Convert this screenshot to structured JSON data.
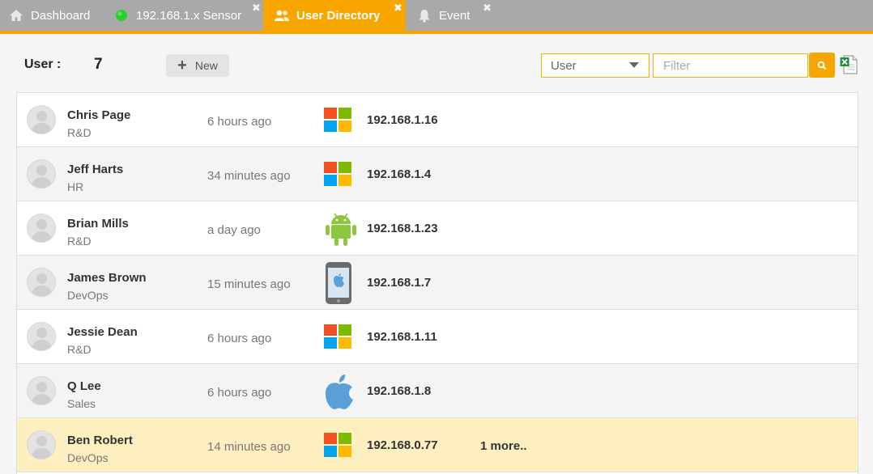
{
  "tabs": [
    {
      "label": "Dashboard",
      "icon": "home-icon"
    },
    {
      "label": "192.168.1.x Sensor",
      "icon": "green-dot-icon",
      "closable": true
    },
    {
      "label": "User Directory",
      "icon": "users-icon",
      "closable": true,
      "active": true
    },
    {
      "label": "Event",
      "icon": "bell-icon",
      "closable": true
    }
  ],
  "header": {
    "user_label": "User :",
    "user_count": "7",
    "new_label": "New",
    "select_value": "User",
    "filter_placeholder": "Filter"
  },
  "colors": {
    "accent": "#f7a600",
    "tabbar": "#a9a9a9",
    "selected_row": "#fdefc0"
  },
  "users": [
    {
      "name": "Chris Page",
      "dept": "R&D",
      "time": "6 hours ago",
      "device": "windows",
      "ip": "192.168.1.16"
    },
    {
      "name": "Jeff Harts",
      "dept": "HR",
      "time": "34 minutes ago",
      "device": "windows",
      "ip": "192.168.1.4"
    },
    {
      "name": "Brian Mills",
      "dept": "R&D",
      "time": "a day ago",
      "device": "android",
      "ip": "192.168.1.23"
    },
    {
      "name": "James Brown",
      "dept": "DevOps",
      "time": "15 minutes ago",
      "device": "iphone",
      "ip": "192.168.1.7"
    },
    {
      "name": "Jessie Dean",
      "dept": "R&D",
      "time": "6 hours ago",
      "device": "windows",
      "ip": "192.168.1.11"
    },
    {
      "name": "Q Lee",
      "dept": "Sales",
      "time": "6 hours ago",
      "device": "apple",
      "ip": "192.168.1.8"
    },
    {
      "name": "Ben Robert",
      "dept": "DevOps",
      "time": "14 minutes ago",
      "device": "windows",
      "ip": "192.168.0.77",
      "more": "1 more..",
      "selected": true
    }
  ]
}
